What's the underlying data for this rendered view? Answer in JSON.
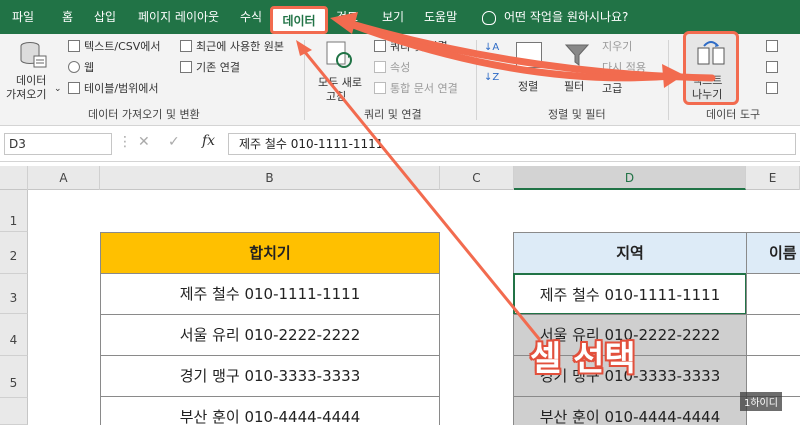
{
  "menu": {
    "tabs": [
      "파일",
      "홈",
      "삽입",
      "페이지 레이아웃",
      "수식",
      "데이터",
      "검토",
      "보기",
      "도움말"
    ],
    "active_tab": "데이터",
    "tell_me": "어떤 작업을 원하시나요?"
  },
  "ribbon": {
    "get_data_label": "데이터",
    "get_data_label2": "가져오기",
    "text_csv": "텍스트/CSV에서",
    "web": "웹",
    "table_range": "테이블/범위에서",
    "recent_sources": "최근에 사용한 원본",
    "existing_connections": "기존 연결",
    "group_get_transform": "데이터 가져오기 및 변환",
    "refresh_all": "모두 새로",
    "refresh_all2": "고침",
    "queries_connections": "쿼리 및 연결",
    "properties": "속성",
    "edit_links": "통합 문서 연결",
    "group_queries": "쿼리 및 연결",
    "sort": "정렬",
    "filter": "필터",
    "clear": "지우기",
    "reapply": "다시 적용",
    "advanced": "고급",
    "group_sort_filter": "정렬 및 필터",
    "text_to_columns": "텍스트",
    "text_to_columns2": "나누기",
    "group_data_tools": "데이터 도구"
  },
  "formula_bar": {
    "name_box": "D3",
    "fx": "fx",
    "formula": "제주 철수 010-1111-1111"
  },
  "grid": {
    "columns": [
      "A",
      "B",
      "C",
      "D",
      "E"
    ],
    "selected_column": "D",
    "rows": [
      "1",
      "2",
      "3",
      "4",
      "5"
    ],
    "header_b": "합치기",
    "header_d": "지역",
    "header_e": "이름",
    "b_values": [
      "제주 철수 010-1111-1111",
      "서울 유리 010-2222-2222",
      "경기 맹구 010-3333-3333",
      "부산 훈이 010-4444-4444"
    ],
    "d_values": [
      "제주 철수 010-1111-1111",
      "서울 유리 010-2222-2222",
      "경기 맹구 010-3333-3333",
      "부산 훈이 010-4444-4444"
    ]
  },
  "annotation": {
    "callout": "셀 선택",
    "accent": "#f26b4f"
  },
  "watermark": "1하이디",
  "colors": {
    "excel_green": "#217346",
    "header_yellow": "#ffc000",
    "header_blue": "#ddebf7"
  }
}
